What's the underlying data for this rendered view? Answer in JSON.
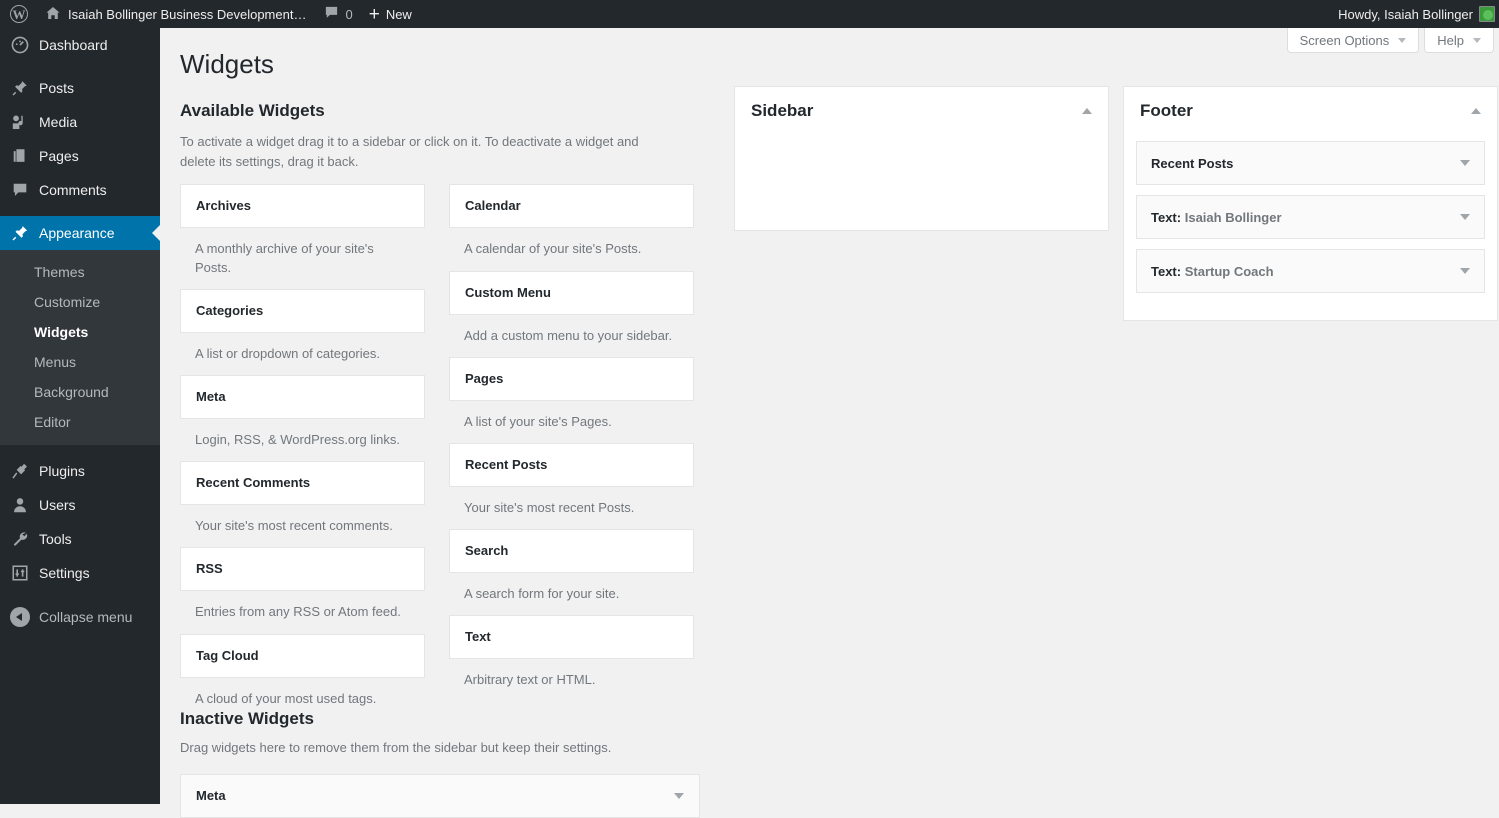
{
  "adminbar": {
    "wp_logo": "wordpress-logo",
    "site_name": "Isaiah Bollinger Business Development…",
    "comment_count": "0",
    "new_label": "New",
    "howdy": "Howdy, Isaiah Bollinger"
  },
  "adminmenu": {
    "items": [
      {
        "label": "Dashboard",
        "icon": "dashboard-icon"
      },
      {
        "label": "Posts",
        "icon": "pin-icon"
      },
      {
        "label": "Media",
        "icon": "media-icon"
      },
      {
        "label": "Pages",
        "icon": "pages-icon"
      },
      {
        "label": "Comments",
        "icon": "comment-icon"
      },
      {
        "label": "Appearance",
        "icon": "brush-icon"
      },
      {
        "label": "Plugins",
        "icon": "plug-icon"
      },
      {
        "label": "Users",
        "icon": "user-icon"
      },
      {
        "label": "Tools",
        "icon": "wrench-icon"
      },
      {
        "label": "Settings",
        "icon": "settings-icon"
      }
    ],
    "submenu": [
      {
        "label": "Themes"
      },
      {
        "label": "Customize"
      },
      {
        "label": "Widgets"
      },
      {
        "label": "Menus"
      },
      {
        "label": "Background"
      },
      {
        "label": "Editor"
      }
    ],
    "collapse_label": "Collapse menu",
    "active_top": "Appearance",
    "active_sub": "Widgets",
    "accent_color": "#0073aa"
  },
  "screen_meta": {
    "screen_options": "Screen Options",
    "help": "Help"
  },
  "page": {
    "title": "Widgets"
  },
  "available": {
    "heading": "Available Widgets",
    "description": "To activate a widget drag it to a sidebar or click on it. To deactivate a widget and delete its settings, drag it back.",
    "left_column": [
      {
        "name": "Archives",
        "desc": "A monthly archive of your site's Posts."
      },
      {
        "name": "Categories",
        "desc": "A list or dropdown of categories."
      },
      {
        "name": "Meta",
        "desc": "Login, RSS, & WordPress.org links."
      },
      {
        "name": "Recent Comments",
        "desc": "Your site's most recent comments."
      },
      {
        "name": "RSS",
        "desc": "Entries from any RSS or Atom feed."
      },
      {
        "name": "Tag Cloud",
        "desc": "A cloud of your most used tags."
      }
    ],
    "right_column": [
      {
        "name": "Calendar",
        "desc": "A calendar of your site's Posts."
      },
      {
        "name": "Custom Menu",
        "desc": "Add a custom menu to your sidebar."
      },
      {
        "name": "Pages",
        "desc": "A list of your site's Pages."
      },
      {
        "name": "Recent Posts",
        "desc": "Your site's most recent Posts."
      },
      {
        "name": "Search",
        "desc": "A search form for your site."
      },
      {
        "name": "Text",
        "desc": "Arbitrary text or HTML."
      }
    ]
  },
  "inactive": {
    "heading": "Inactive Widgets",
    "description": "Drag widgets here to remove them from the sidebar but keep their settings.",
    "widgets": [
      {
        "name": "Meta"
      }
    ]
  },
  "sidebar_area": {
    "title": "Sidebar",
    "widgets": []
  },
  "footer_area": {
    "title": "Footer",
    "widgets": [
      {
        "type": "Recent Posts",
        "instance": ""
      },
      {
        "type": "Text:",
        "instance": "Isaiah Bollinger"
      },
      {
        "type": "Text:",
        "instance": "Startup Coach"
      }
    ]
  }
}
